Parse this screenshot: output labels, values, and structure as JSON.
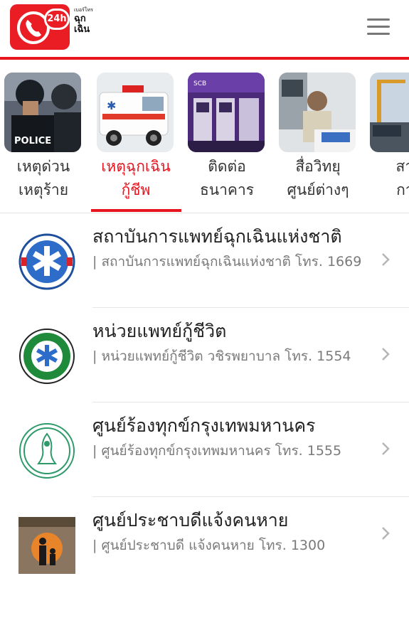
{
  "header": {
    "logo_badge": "24h",
    "logo_small": "เบอร์โทร",
    "logo_line1": "ฉุก",
    "logo_line2": "เฉิน",
    "brand_color": "#e8141e"
  },
  "categories": [
    {
      "line1": "เหตุด่วน",
      "line2": "เหตุร้าย",
      "image": "police-photo",
      "active": false
    },
    {
      "line1": "เหตุฉุกเฉิน",
      "line2": "กู้ชีพ",
      "image": "ambulance-photo",
      "active": true
    },
    {
      "line1": "ติดต่อ",
      "line2": "ธนาคาร",
      "image": "bank-atm-photo",
      "active": false
    },
    {
      "line1": "สื่อวิทยุ",
      "line2": "ศูนย์ต่างๆ",
      "image": "radio-operator-photo",
      "active": false
    },
    {
      "line1": "สาย",
      "line2": "การ",
      "image": "port-cranes-photo",
      "active": false
    }
  ],
  "contacts": [
    {
      "title": "สถาบันการแพทย์ฉุกเฉินแห่งชาติ",
      "desc": "| สถาบันการแพทย์ฉุกเฉินแห่งชาติ โทร. 1669",
      "icon": "niems-logo-icon"
    },
    {
      "title": "หน่วยแพทย์กู้ชีวิต",
      "desc": "| หน่วยแพทย์กู้ชีวิต วชิรพยาบาล โทร. 1554",
      "icon": "smlk-logo-icon"
    },
    {
      "title": "ศูนย์ร้องทุกข์กรุงเทพมหานคร",
      "desc": "| ศูนย์ร้องทุกข์กรุงเทพมหานคร โทร. 1555",
      "icon": "bangkok-seal-icon"
    },
    {
      "title": "ศูนย์ประชาบดีแจ้งคนหาย",
      "desc": "| ศูนย์ประชาบดี แจ้งคนหาย โทร. 1300",
      "icon": "missing-persons-logo-icon"
    }
  ]
}
